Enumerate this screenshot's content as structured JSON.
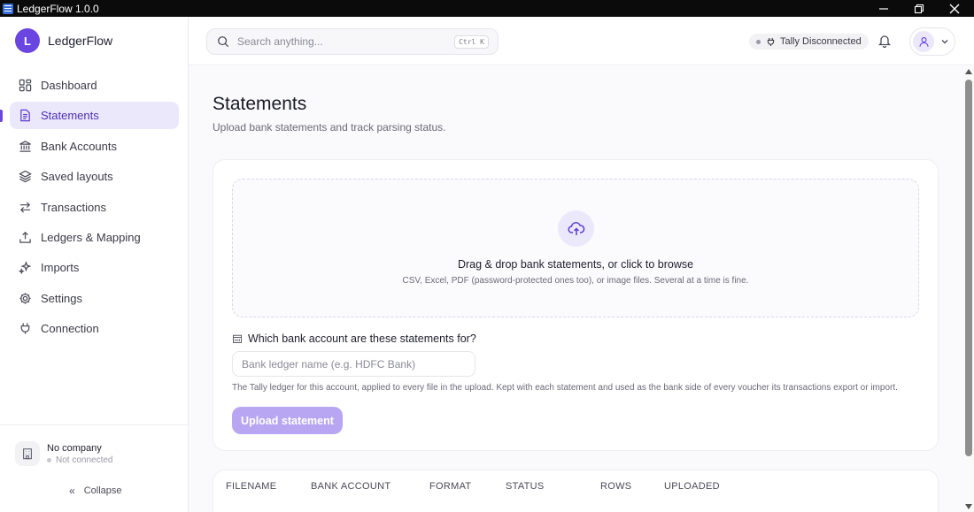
{
  "window": {
    "title": "LedgerFlow 1.0.0"
  },
  "brand": {
    "logo_letter": "L",
    "name": "LedgerFlow",
    "accent": "#6b45e0"
  },
  "sidebar": {
    "items": [
      {
        "label": "Dashboard",
        "icon": "dashboard-icon",
        "active": false
      },
      {
        "label": "Statements",
        "icon": "document-icon",
        "active": true
      },
      {
        "label": "Bank Accounts",
        "icon": "bank-icon",
        "active": false
      },
      {
        "label": "Saved layouts",
        "icon": "layers-icon",
        "active": false
      },
      {
        "label": "Transactions",
        "icon": "arrows-swap-icon",
        "active": false
      },
      {
        "label": "Ledgers & Mapping",
        "icon": "upload-tray-icon",
        "active": false
      },
      {
        "label": "Imports",
        "icon": "sparkles-icon",
        "active": false
      },
      {
        "label": "Settings",
        "icon": "gear-icon",
        "active": false
      },
      {
        "label": "Connection",
        "icon": "plug-icon",
        "active": false
      }
    ],
    "company": {
      "name": "No company",
      "status": "Not connected"
    },
    "collapse_label": "Collapse"
  },
  "header": {
    "search_placeholder": "Search anything...",
    "shortcut": "Ctrl K",
    "tally_status": "Tally Disconnected"
  },
  "main": {
    "title": "Statements",
    "subtitle": "Upload bank statements and track parsing status.",
    "dropzone": {
      "title": "Drag & drop bank statements, or click to browse",
      "hint": "CSV, Excel, PDF (password-protected ones too), or image files. Several at a time is fine."
    },
    "account_question": "Which bank account are these statements for?",
    "account_placeholder": "Bank ledger name (e.g. HDFC Bank)",
    "account_help": "The Tally ledger for this account, applied to every file in the upload. Kept with each statement and used as the bank side of every voucher its transactions export or import.",
    "upload_button": "Upload statement",
    "table_columns": [
      "FILENAME",
      "BANK ACCOUNT",
      "FORMAT",
      "STATUS",
      "ROWS",
      "UPLOADED"
    ]
  }
}
